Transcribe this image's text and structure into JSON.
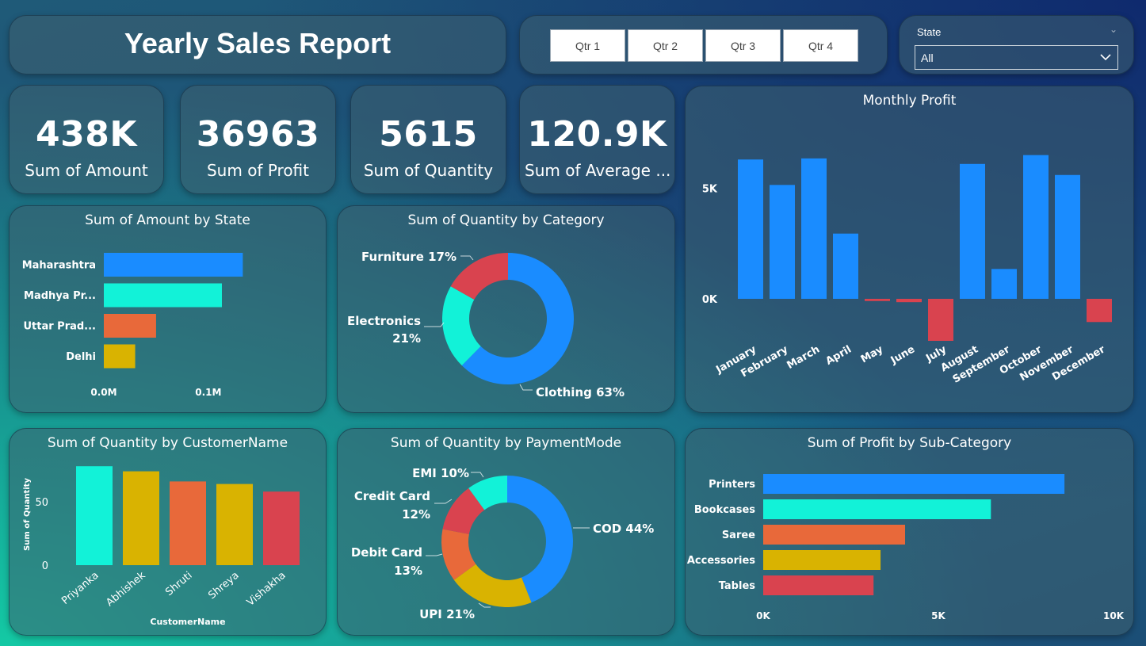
{
  "title": "Yearly Sales Report",
  "quarters": [
    "Qtr 1",
    "Qtr 2",
    "Qtr 3",
    "Qtr 4"
  ],
  "state_filter": {
    "label": "State",
    "value": "All"
  },
  "kpis": [
    {
      "value": "438K",
      "label": "Sum of Amount"
    },
    {
      "value": "36963",
      "label": "Sum of Profit"
    },
    {
      "value": "5615",
      "label": "Sum of Quantity"
    },
    {
      "value": "120.9K",
      "label": "Sum of Average ..."
    }
  ],
  "colors": {
    "blue": "#1a8cff",
    "cyan": "#12f2d8",
    "orange": "#e8693a",
    "yellow": "#d9b301",
    "red": "#d9434f"
  },
  "chart_data": [
    {
      "id": "amount_by_state",
      "type": "bar",
      "orientation": "horizontal",
      "title": "Sum of Amount by State",
      "categories": [
        "Maharashtra",
        "Madhya Pr...",
        "Uttar Prad...",
        "Delhi"
      ],
      "values": [
        0.133,
        0.113,
        0.05,
        0.03
      ],
      "xticks": [
        "0.0M",
        "0.1M"
      ],
      "tick_values": [
        0,
        0.1
      ],
      "xlim": [
        0,
        0.135
      ],
      "colors": [
        "#1a8cff",
        "#12f2d8",
        "#e8693a",
        "#d9b301"
      ]
    },
    {
      "id": "quantity_by_category",
      "type": "pie",
      "donut": true,
      "title": "Sum of Quantity by Category",
      "labels": [
        "Clothing",
        "Electronics",
        "Furniture"
      ],
      "values": [
        63,
        21,
        17
      ],
      "display": [
        "Clothing 63%",
        "Electronics",
        "21%",
        "Furniture 17%"
      ],
      "colors": [
        "#1a8cff",
        "#12f2d8",
        "#d9434f"
      ]
    },
    {
      "id": "monthly_profit",
      "type": "bar",
      "title": "Monthly Profit",
      "categories": [
        "January",
        "February",
        "March",
        "April",
        "May",
        "June",
        "July",
        "August",
        "September",
        "October",
        "November",
        "December"
      ],
      "values": [
        6300,
        5150,
        6350,
        2950,
        -100,
        -150,
        -1900,
        6100,
        1350,
        6500,
        5600,
        -1050
      ],
      "yticks": [
        "0K",
        "5K"
      ],
      "tick_values": [
        0,
        5000
      ],
      "ylim": [
        -2000,
        7000
      ],
      "positive_color": "#1a8cff",
      "negative_color": "#d9434f"
    },
    {
      "id": "quantity_by_customer",
      "type": "bar",
      "title": "Sum of Quantity by CustomerName",
      "xlabel": "CustomerName",
      "ylabel": "Sum of Quantity",
      "categories": [
        "Priyanka",
        "Abhishek",
        "Shruti",
        "Shreya",
        "Vishakha"
      ],
      "values": [
        78,
        74,
        66,
        64,
        58
      ],
      "yticks": [
        "0",
        "50"
      ],
      "tick_values": [
        0,
        50
      ],
      "ylim": [
        0,
        80
      ],
      "colors": [
        "#12f2d8",
        "#d9b301",
        "#e8693a",
        "#d9b301",
        "#d9434f"
      ]
    },
    {
      "id": "quantity_by_payment",
      "type": "pie",
      "donut": true,
      "title": "Sum of Quantity by PaymentMode",
      "labels": [
        "COD",
        "UPI",
        "Debit Card",
        "Credit Card",
        "EMI"
      ],
      "values": [
        44,
        21,
        13,
        12,
        10
      ],
      "display": [
        "COD 44%",
        "UPI 21%",
        "Debit Card",
        "13%",
        "Credit Card",
        "12%",
        "EMI 10%"
      ],
      "colors": [
        "#1a8cff",
        "#d9b301",
        "#e8693a",
        "#d9434f",
        "#12f2d8"
      ]
    },
    {
      "id": "profit_by_subcategory",
      "type": "bar",
      "orientation": "horizontal",
      "title": "Sum of Profit by Sub-Category",
      "categories": [
        "Printers",
        "Bookcases",
        "Saree",
        "Accessories",
        "Tables"
      ],
      "values": [
        8600,
        6500,
        4050,
        3350,
        3150
      ],
      "xticks": [
        "0K",
        "5K",
        "10K"
      ],
      "tick_values": [
        0,
        5000,
        10000
      ],
      "xlim": [
        0,
        10000
      ],
      "colors": [
        "#1a8cff",
        "#12f2d8",
        "#e8693a",
        "#d9b301",
        "#d9434f"
      ]
    }
  ]
}
